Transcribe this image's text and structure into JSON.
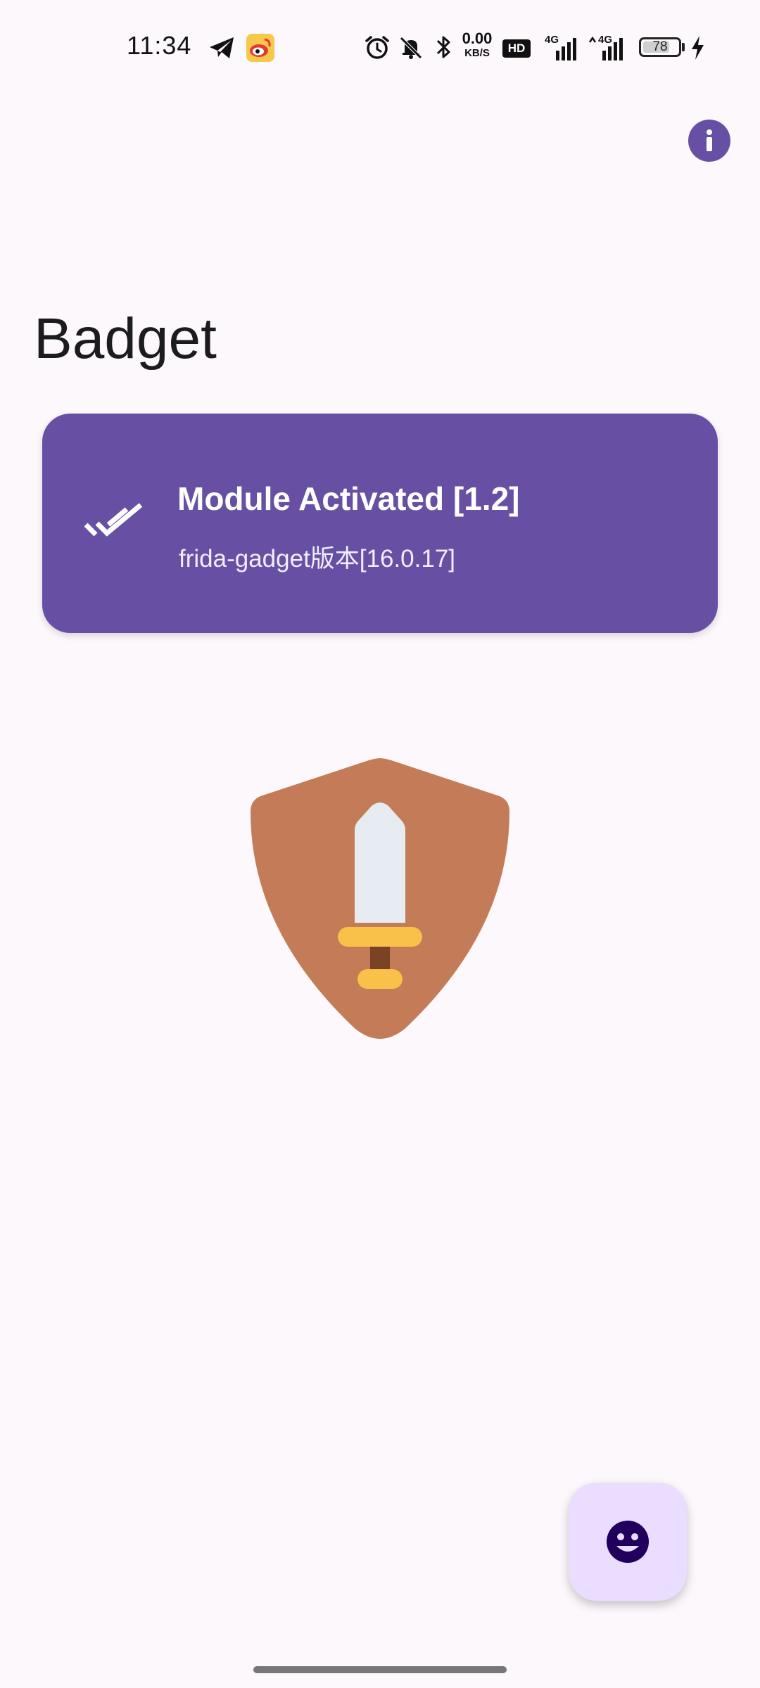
{
  "status_bar": {
    "time": "11:34",
    "net_speed_value": "0.00",
    "net_speed_unit": "KB/S",
    "hd_label": "HD",
    "signal1_label": "4G",
    "signal2_label": "4G",
    "battery_level": "78",
    "battery_fraction": 0.78,
    "icons": [
      "telegram-icon",
      "weibo-icon",
      "alarm-icon",
      "mute-icon",
      "bluetooth-icon",
      "charging-icon"
    ]
  },
  "header": {
    "info_icon": "info-icon"
  },
  "page": {
    "title": "Badget"
  },
  "status_card": {
    "icon": "done-all-icon",
    "title": "Module Activated [1.2]",
    "subtitle": "frida-gadget版本[16.0.17]"
  },
  "illustration": {
    "icon": "shield-sword-icon",
    "colors": {
      "shield": "#c47b57",
      "blade": "#e6ecf1",
      "guard": "#f9c04a",
      "grip": "#7a4424"
    }
  },
  "fab": {
    "icon": "smiley-face-icon"
  },
  "colors": {
    "background": "#fdf8fc",
    "primary": "#6750a4",
    "fab_container": "#eaddff",
    "fab_icon": "#21005d"
  }
}
